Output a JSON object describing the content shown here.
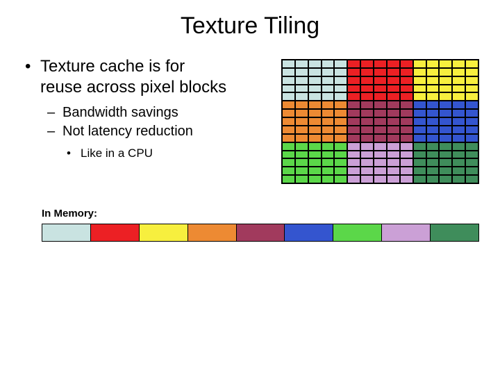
{
  "title": "Texture Tiling",
  "bullets": {
    "l1": "Texture cache is for reuse across pixel blocks",
    "l2a": "Bandwidth savings",
    "l2b": "Not latency reduction",
    "l3": "Like in a CPU"
  },
  "mem_label": "In Memory:",
  "tile_colors": [
    "#c9e3e1",
    "#ec2024",
    "#f7ef3e",
    "#ed8a33",
    "#a13a5d",
    "#3455cf",
    "#5bd749",
    "#cba0d6",
    "#3f8d5b"
  ],
  "mem_colors": [
    "#c9e3e1",
    "#ec2024",
    "#f7ef3e",
    "#ed8a33",
    "#a13a5d",
    "#3455cf",
    "#5bd749",
    "#cba0d6",
    "#3f8d5b"
  ]
}
